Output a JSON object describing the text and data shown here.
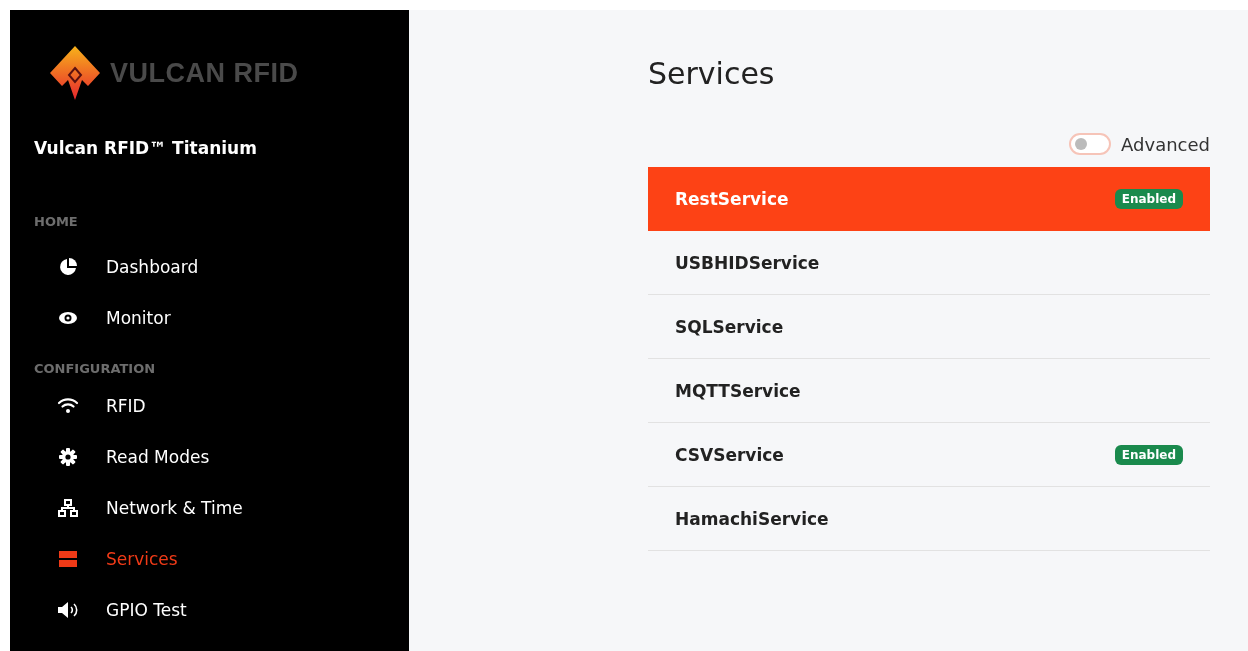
{
  "sidebar": {
    "logo": "VULCAN RFID",
    "product": "Vulcan RFID™ Titanium",
    "sections": [
      {
        "title": "HOME",
        "items": [
          {
            "label": "Dashboard",
            "kind": "pie",
            "selected": false
          },
          {
            "label": "Monitor",
            "kind": "eye",
            "selected": false
          }
        ]
      },
      {
        "title": "CONFIGURATION",
        "items": [
          {
            "label": "RFID",
            "kind": "wifi",
            "selected": false
          },
          {
            "label": "Read Modes",
            "kind": "gear",
            "selected": false
          },
          {
            "label": "Network & Time",
            "kind": "network",
            "selected": false
          },
          {
            "label": "Services",
            "kind": "server",
            "selected": true
          },
          {
            "label": "GPIO Test",
            "kind": "speaker",
            "selected": false
          }
        ]
      }
    ]
  },
  "page": {
    "title": "Services",
    "advanced": {
      "label": "Advanced",
      "on": false
    },
    "services": [
      {
        "name": "RestService",
        "selected": true,
        "badge": "Enabled"
      },
      {
        "name": "USBHIDService",
        "selected": false
      },
      {
        "name": "SQLService",
        "selected": false
      },
      {
        "name": "MQTTService",
        "selected": false
      },
      {
        "name": "CSVService",
        "selected": false,
        "badge": "Enabled"
      },
      {
        "name": "HamachiService",
        "selected": false
      }
    ]
  }
}
